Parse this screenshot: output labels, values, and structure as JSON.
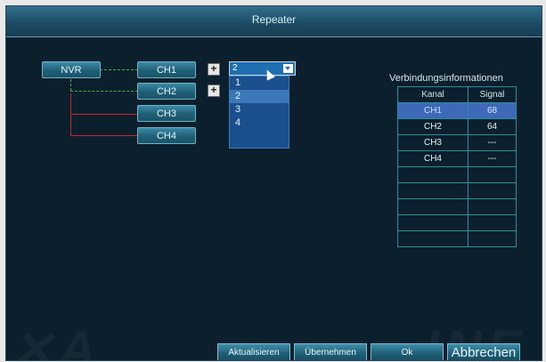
{
  "window": {
    "title": "Repeater"
  },
  "topology": {
    "nvr_label": "NVR",
    "channels": [
      {
        "label": "CH1"
      },
      {
        "label": "CH2"
      },
      {
        "label": "CH3"
      },
      {
        "label": "CH4"
      }
    ],
    "plus_symbol": "+"
  },
  "select": {
    "value": "2",
    "options": [
      "1",
      "2",
      "3",
      "4"
    ],
    "highlighted": "2"
  },
  "info": {
    "title": "Verbindungsinformationen",
    "headers": [
      "Kanal",
      "Signal"
    ],
    "rows": [
      {
        "kanal": "CH1",
        "signal": "68"
      },
      {
        "kanal": "CH2",
        "signal": "64"
      },
      {
        "kanal": "CH3",
        "signal": "---"
      },
      {
        "kanal": "CH4",
        "signal": "---"
      }
    ],
    "selected_row": 0
  },
  "buttons": {
    "refresh": "Aktualisieren",
    "apply": "Übernehmen",
    "ok": "Ok",
    "cancel": "Abbrechen"
  },
  "colors": {
    "link_green": "#3fb34a",
    "link_red": "#c8262a",
    "selection": "#3d69b8"
  }
}
